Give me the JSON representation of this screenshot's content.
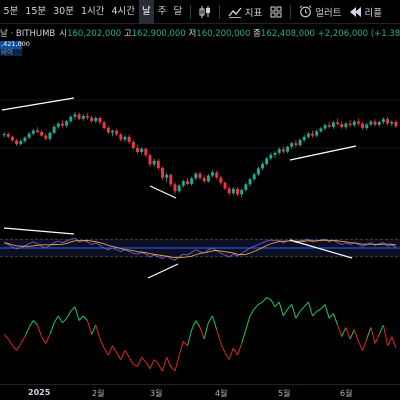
{
  "toolbar": {
    "timeframes": [
      "5분",
      "15분",
      "30분",
      "1시간",
      "4시간",
      "날",
      "주",
      "달"
    ],
    "active_timeframe": "날",
    "indicators_label": "지표",
    "alerts_label": "얼러트",
    "replay_label": "리플"
  },
  "legend": {
    "symbol": "날 · BITHUMB",
    "open_label": "시",
    "open": "160,202,000",
    "high_label": "고",
    "high": "162,900,000",
    "low_label": "저",
    "low": "160,200,000",
    "close_label": "종",
    "close": "162,408,000",
    "change": "+2,206,000 (+1.38%)"
  },
  "price_badge": {
    "price": ",421,000",
    "bid_label": "비이"
  },
  "colors": {
    "up": "#22ab94",
    "down": "#f23645",
    "rsi_line": "#7e57c2",
    "signal_line": "#e0a94a",
    "level_line": "#2962ff",
    "osc_up": "#22c55e",
    "osc_down": "#dc2626",
    "trendline": "#ffffff"
  },
  "x_axis": {
    "labels": [
      "2025",
      "2월",
      "3월",
      "4월",
      "5월",
      "6월"
    ]
  },
  "chart_data": {
    "type": "candlestick",
    "series": [
      {
        "name": "BITHUMB",
        "candles": [
          [
            150.2,
            151.0,
            149.6,
            150.5
          ],
          [
            150.5,
            150.9,
            149.4,
            149.8
          ],
          [
            149.8,
            150.1,
            148.6,
            148.9
          ],
          [
            148.9,
            149.3,
            147.5,
            148.0
          ],
          [
            148.0,
            149.1,
            147.6,
            148.7
          ],
          [
            148.7,
            149.9,
            148.3,
            149.6
          ],
          [
            149.6,
            151.0,
            149.2,
            150.6
          ],
          [
            150.6,
            151.8,
            150.2,
            151.4
          ],
          [
            151.4,
            152.2,
            150.8,
            151.0
          ],
          [
            151.0,
            151.5,
            149.8,
            150.1
          ],
          [
            150.1,
            150.6,
            148.9,
            149.3
          ],
          [
            149.3,
            151.1,
            148.8,
            150.8
          ],
          [
            150.8,
            152.8,
            150.4,
            152.3
          ],
          [
            152.3,
            153.5,
            151.8,
            153.1
          ],
          [
            153.1,
            153.9,
            152.2,
            152.6
          ],
          [
            152.6,
            154.0,
            152.1,
            153.7
          ],
          [
            153.7,
            155.2,
            153.2,
            154.8
          ],
          [
            154.8,
            156.0,
            154.1,
            155.4
          ],
          [
            155.4,
            155.9,
            154.0,
            154.3
          ],
          [
            154.3,
            155.5,
            153.8,
            155.0
          ],
          [
            155.0,
            155.8,
            154.1,
            154.6
          ],
          [
            154.6,
            155.1,
            153.2,
            153.7
          ],
          [
            153.7,
            154.9,
            153.2,
            154.5
          ],
          [
            154.5,
            154.9,
            152.9,
            153.4
          ],
          [
            153.4,
            153.8,
            151.6,
            152.0
          ],
          [
            152.0,
            152.5,
            150.4,
            150.9
          ],
          [
            150.9,
            151.6,
            149.9,
            151.3
          ],
          [
            151.3,
            151.8,
            150.0,
            150.4
          ],
          [
            150.4,
            150.8,
            148.7,
            149.1
          ],
          [
            149.1,
            150.2,
            148.5,
            149.8
          ],
          [
            149.8,
            150.3,
            148.0,
            148.5
          ],
          [
            148.5,
            148.9,
            146.6,
            147.0
          ],
          [
            147.0,
            147.8,
            145.5,
            146.0
          ],
          [
            146.0,
            147.2,
            145.3,
            146.8
          ],
          [
            146.8,
            147.1,
            144.7,
            145.2
          ],
          [
            145.2,
            145.6,
            142.3,
            142.9
          ],
          [
            142.9,
            144.3,
            142.2,
            143.8
          ],
          [
            143.8,
            144.3,
            141.5,
            142.0
          ],
          [
            142.0,
            142.4,
            139.0,
            139.6
          ],
          [
            139.6,
            140.8,
            138.5,
            140.3
          ],
          [
            140.3,
            140.7,
            137.3,
            137.9
          ],
          [
            137.9,
            138.5,
            135.5,
            136.2
          ],
          [
            136.2,
            138.0,
            135.8,
            137.6
          ],
          [
            137.6,
            139.1,
            137.1,
            138.7
          ],
          [
            138.7,
            139.5,
            137.6,
            138.0
          ],
          [
            138.0,
            139.8,
            137.6,
            139.4
          ],
          [
            139.4,
            141.0,
            139.0,
            140.6
          ],
          [
            140.6,
            141.1,
            139.0,
            139.5
          ],
          [
            139.5,
            140.2,
            138.2,
            138.7
          ],
          [
            138.7,
            140.5,
            138.3,
            140.1
          ],
          [
            140.1,
            141.4,
            139.6,
            140.9
          ],
          [
            140.9,
            141.3,
            139.2,
            139.6
          ],
          [
            139.6,
            140.0,
            137.8,
            138.3
          ],
          [
            138.3,
            138.7,
            136.4,
            136.9
          ],
          [
            136.9,
            137.5,
            135.1,
            135.7
          ],
          [
            135.7,
            137.2,
            135.3,
            136.8
          ],
          [
            136.8,
            137.2,
            135.0,
            135.4
          ],
          [
            135.4,
            136.9,
            134.6,
            136.5
          ],
          [
            136.5,
            138.3,
            136.1,
            137.9
          ],
          [
            137.9,
            139.6,
            137.4,
            139.2
          ],
          [
            139.2,
            140.8,
            138.8,
            140.4
          ],
          [
            140.4,
            142.3,
            140.0,
            141.9
          ],
          [
            141.9,
            143.5,
            141.5,
            143.0
          ],
          [
            143.0,
            144.8,
            142.6,
            144.4
          ],
          [
            144.4,
            145.9,
            143.9,
            145.3
          ],
          [
            145.3,
            146.1,
            144.5,
            145.8
          ],
          [
            145.8,
            147.2,
            145.3,
            146.7
          ],
          [
            146.7,
            147.4,
            145.6,
            146.1
          ],
          [
            146.1,
            147.6,
            145.7,
            147.3
          ],
          [
            147.3,
            148.6,
            146.8,
            148.2
          ],
          [
            148.2,
            149.0,
            147.2,
            147.7
          ],
          [
            147.7,
            149.4,
            147.3,
            149.0
          ],
          [
            149.0,
            150.2,
            148.5,
            149.8
          ],
          [
            149.8,
            151.0,
            149.3,
            150.6
          ],
          [
            150.6,
            151.3,
            149.6,
            150.1
          ],
          [
            150.1,
            151.6,
            149.7,
            151.2
          ],
          [
            151.2,
            152.3,
            150.7,
            151.9
          ],
          [
            151.9,
            153.1,
            151.4,
            152.7
          ],
          [
            152.7,
            153.5,
            151.9,
            152.3
          ],
          [
            152.3,
            153.8,
            151.8,
            153.4
          ],
          [
            153.4,
            154.3,
            152.6,
            153.0
          ],
          [
            153.0,
            153.6,
            151.8,
            152.2
          ],
          [
            152.2,
            153.5,
            151.7,
            153.1
          ],
          [
            153.1,
            154.0,
            152.2,
            152.7
          ],
          [
            152.7,
            153.9,
            152.2,
            153.6
          ],
          [
            153.6,
            154.4,
            152.6,
            153.1
          ],
          [
            153.1,
            153.5,
            151.6,
            152.0
          ],
          [
            152.0,
            153.3,
            151.5,
            152.9
          ],
          [
            152.9,
            154.0,
            152.4,
            153.6
          ],
          [
            153.6,
            154.2,
            152.4,
            152.8
          ],
          [
            152.8,
            153.9,
            152.3,
            153.5
          ],
          [
            153.5,
            154.6,
            153.0,
            154.2
          ],
          [
            154.2,
            154.8,
            152.7,
            153.1
          ],
          [
            153.1,
            153.9,
            152.5,
            153.5
          ],
          [
            153.5,
            154.1,
            151.9,
            152.4
          ]
        ]
      }
    ],
    "oscillator": {
      "name": "RSI",
      "values": [
        62,
        58,
        52,
        48,
        50,
        55,
        60,
        64,
        60,
        54,
        50,
        56,
        62,
        66,
        62,
        66,
        70,
        72,
        64,
        67,
        64,
        58,
        62,
        56,
        50,
        46,
        50,
        46,
        42,
        46,
        42,
        38,
        36,
        40,
        36,
        30,
        34,
        30,
        26,
        32,
        26,
        22,
        30,
        36,
        34,
        40,
        46,
        42,
        38,
        46,
        50,
        44,
        38,
        34,
        30,
        36,
        32,
        38,
        44,
        50,
        54,
        58,
        62,
        66,
        68,
        66,
        68,
        62,
        66,
        68,
        62,
        66,
        68,
        70,
        64,
        67,
        68,
        70,
        64,
        68,
        62,
        58,
        62,
        58,
        62,
        58,
        54,
        58,
        62,
        56,
        60,
        62,
        54,
        57,
        52
      ],
      "levels": [
        70,
        50,
        30
      ],
      "ylim": [
        0,
        100
      ]
    },
    "momentum": {
      "name": "Oscillator",
      "values": [
        -2,
        -6,
        -12,
        -16,
        -10,
        -4,
        4,
        10,
        6,
        -4,
        -10,
        -2,
        8,
        14,
        8,
        12,
        18,
        22,
        10,
        14,
        10,
        -2,
        6,
        -6,
        -14,
        -20,
        -12,
        -18,
        -24,
        -16,
        -22,
        -28,
        -30,
        -22,
        -26,
        -32,
        -24,
        -28,
        -34,
        -22,
        -30,
        -34,
        -20,
        -8,
        -12,
        2,
        10,
        4,
        -6,
        8,
        14,
        2,
        -10,
        -18,
        -24,
        -14,
        -20,
        -10,
        2,
        14,
        20,
        24,
        26,
        30,
        28,
        22,
        26,
        14,
        20,
        24,
        12,
        18,
        22,
        26,
        14,
        18,
        20,
        24,
        12,
        16,
        6,
        -4,
        4,
        -6,
        2,
        -8,
        -16,
        -6,
        4,
        -10,
        -2,
        6,
        -12,
        -4,
        -14
      ],
      "ylim": [
        -40,
        40
      ]
    },
    "ylim": [
      131,
      160
    ]
  }
}
